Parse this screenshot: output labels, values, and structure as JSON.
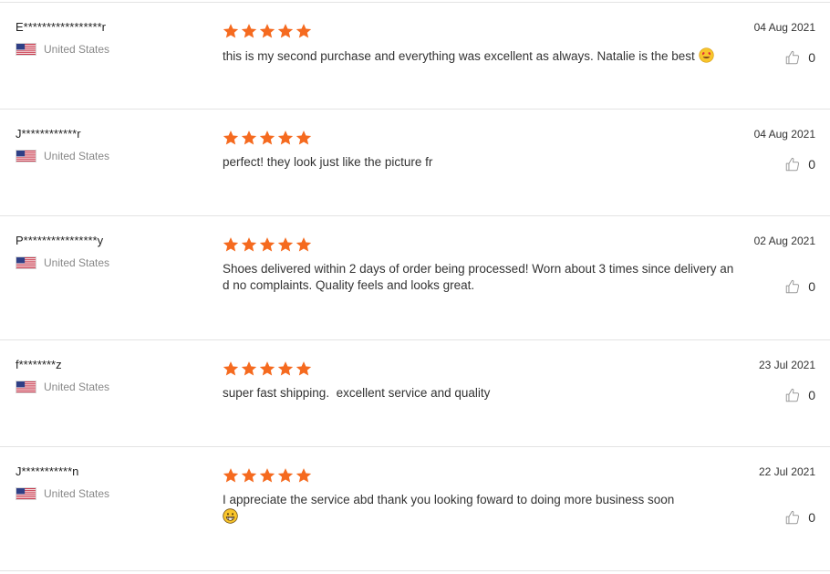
{
  "colors": {
    "star": "#f56a1f",
    "divider": "#e3e3e3",
    "muted_text": "#888888"
  },
  "icons": {
    "star": "star-icon",
    "like": "thumbs-up-icon",
    "flag": "us-flag-icon"
  },
  "reviews": [
    {
      "reviewer": "E*****************r",
      "country": "United States",
      "rating": 5,
      "text": "this is my second purchase and everything was excellent as always. Natalie is the best ",
      "emoji": "heart-eyes-emoji",
      "date": "04 Aug 2021",
      "likes": "0"
    },
    {
      "reviewer": "J************r",
      "country": "United States",
      "rating": 5,
      "text": "perfect! they look just like the picture fr",
      "emoji": "",
      "date": "04 Aug 2021",
      "likes": "0"
    },
    {
      "reviewer": "P****************y",
      "country": "United States",
      "rating": 5,
      "text": "Shoes delivered within 2 days of order being processed! Worn about 3 times since delivery and no complaints. Quality feels and looks great.",
      "emoji": "",
      "date": "02 Aug 2021",
      "likes": "0"
    },
    {
      "reviewer": "f********z",
      "country": "United States",
      "rating": 5,
      "text": "super fast shipping.  excellent service and quality",
      "emoji": "",
      "date": "23 Jul 2021",
      "likes": "0"
    },
    {
      "reviewer": "J***********n",
      "country": "United States",
      "rating": 5,
      "text": "I appreciate the service abd thank you looking foward to doing more business soon\n",
      "emoji": "grinning-emoji",
      "date": "22 Jul 2021",
      "likes": "0"
    }
  ]
}
